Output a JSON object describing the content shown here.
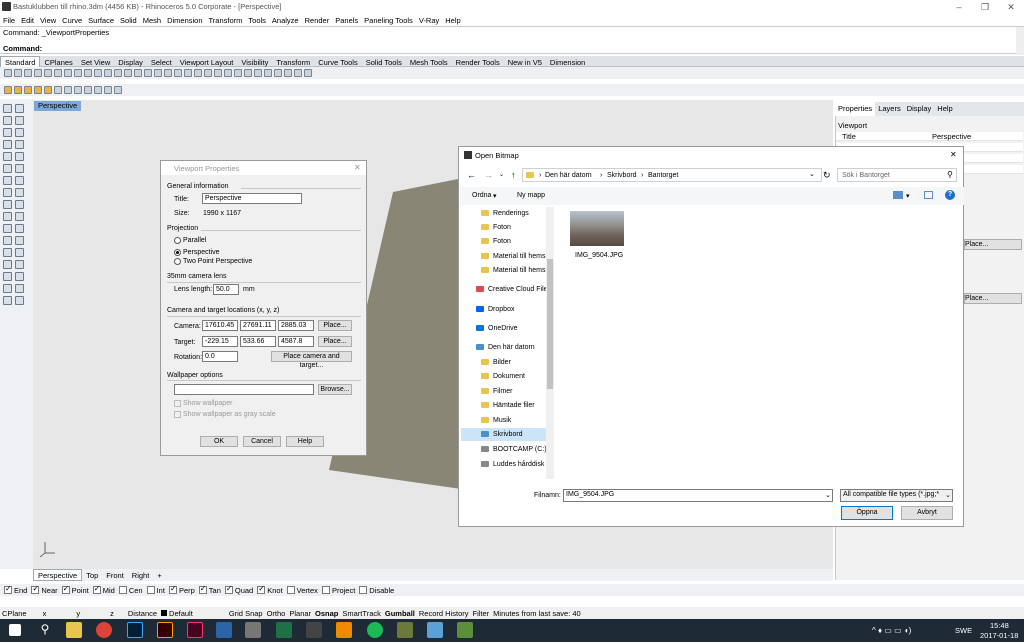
{
  "window": {
    "title": "Bastuklubben till rhino.3dm (4456 KB) - Rhinoceros  5.0 Corporate - [Perspective]"
  },
  "menu": [
    "File",
    "Edit",
    "View",
    "Curve",
    "Surface",
    "Solid",
    "Mesh",
    "Dimension",
    "Transform",
    "Tools",
    "Analyze",
    "Render",
    "Panels",
    "Paneling Tools",
    "V-Ray",
    "Help"
  ],
  "command": {
    "history": "Command: _ViewportProperties",
    "prompt": "Command:"
  },
  "toolbar_tabs": [
    "Standard",
    "CPlanes",
    "Set View",
    "Display",
    "Select",
    "Viewport Layout",
    "Visibility",
    "Transform",
    "Curve Tools",
    "Solid Tools",
    "Mesh Tools",
    "Render Tools",
    "New in V5",
    "Dimension"
  ],
  "viewport": {
    "title": "Perspective",
    "bottom_tabs": [
      "Perspective",
      "Top",
      "Front",
      "Right",
      "+"
    ]
  },
  "right_panel": {
    "tabs": [
      "Properties",
      "Layers",
      "Display",
      "Help"
    ],
    "section": "Viewport",
    "title_label": "Title",
    "title_value": "Perspective",
    "place_label": "Place..."
  },
  "osnaps": [
    {
      "label": "End",
      "on": true
    },
    {
      "label": "Near",
      "on": true
    },
    {
      "label": "Point",
      "on": true
    },
    {
      "label": "Mid",
      "on": true
    },
    {
      "label": "Cen",
      "on": false
    },
    {
      "label": "Int",
      "on": false
    },
    {
      "label": "Perp",
      "on": true
    },
    {
      "label": "Tan",
      "on": true
    },
    {
      "label": "Quad",
      "on": true
    },
    {
      "label": "Knot",
      "on": true
    },
    {
      "label": "Vertex",
      "on": false
    },
    {
      "label": "Project",
      "on": false
    },
    {
      "label": "Disable",
      "on": false
    }
  ],
  "status": {
    "cplane": "CPlane",
    "x": "x",
    "y": "y",
    "z": "z",
    "distance": "Distance",
    "layer": "Default",
    "toggles": [
      "Grid Snap",
      "Ortho",
      "Planar",
      "Osnap",
      "SmartTrack",
      "Gumball",
      "Record History",
      "Filter"
    ],
    "last_save": "Minutes from last save: 40"
  },
  "taskbar": {
    "time": "15:48",
    "date": "2017-01-18",
    "lang": "SWE"
  },
  "viewport_properties": {
    "title": "Viewport Properties",
    "general_label": "General information",
    "title_label": "Title:",
    "title_value": "Perspective",
    "size_label": "Size:",
    "size_value": "1990 x 1167",
    "projection_label": "Projection",
    "proj_parallel": "Parallel",
    "proj_perspective": "Perspective",
    "proj_twopoint": "Two Point Perspective",
    "lens_section": "35mm camera lens",
    "lens_label": "Lens length:",
    "lens_value": "50.0",
    "lens_unit": "mm",
    "cam_section": "Camera and target locations (x, y, z)",
    "camera_label": "Camera:",
    "camera_x": "17610.45",
    "camera_y": "27691.11",
    "camera_z": "2885.03",
    "target_label": "Target:",
    "target_x": "-229.15",
    "target_y": "533.66",
    "target_z": "4587.8",
    "rotation_label": "Rotation:",
    "rotation_value": "0.0",
    "place": "Place...",
    "place_both": "Place camera and target...",
    "wallpaper_section": "Wallpaper options",
    "browse": "Browse...",
    "show_wallpaper": "Show wallpaper",
    "show_gray": "Show wallpaper as gray scale",
    "ok": "OK",
    "cancel": "Cancel",
    "help": "Help"
  },
  "open_bitmap": {
    "title": "Open Bitmap",
    "breadcrumb": [
      "Den här datorn",
      "Skrivbord",
      "Bantorget"
    ],
    "search_placeholder": "Sök i Bantorget",
    "organize": "Ordna",
    "new_folder": "Ny mapp",
    "nav": [
      "Renderings",
      "Foton",
      "Foton",
      "Material till hems",
      "Material till hems",
      "Creative Cloud File",
      "Dropbox",
      "OneDrive",
      "Den här datorn",
      "Bilder",
      "Dokument",
      "Filmer",
      "Hämtade filer",
      "Musik",
      "Skrivbord",
      "BOOTCAMP (C:)",
      "Luddes hårddisk"
    ],
    "file_name": "IMG_9504.JPG",
    "filename_label": "Filnamn:",
    "filename_value": "IMG_9504.JPG",
    "filter": "All compatible file types (*.jpg;*",
    "open": "Öppna",
    "cancel": "Avbryt"
  }
}
